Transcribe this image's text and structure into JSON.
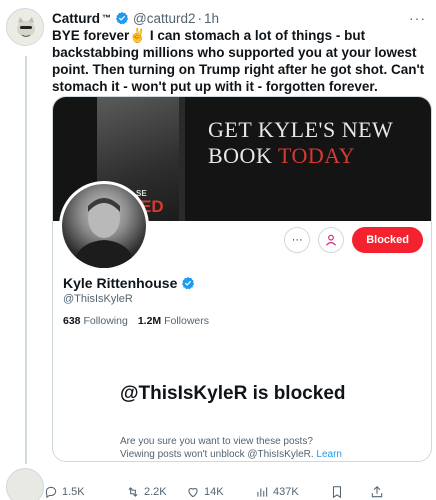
{
  "tweet": {
    "author_name": "Catturd",
    "author_tm": "™",
    "handle": "@catturd2",
    "separator": "·",
    "time": "1h",
    "more": "···",
    "text": "BYE forever✌️ I can stomach a lot of things - but backstabbing millions who supported you at your lowest point. Then turning on Trump right after he got shot. Can't stomach it - won't put up with it - forgotten forever."
  },
  "embed": {
    "banner": {
      "line1": "GET KYLE'S NEW",
      "line2_plain": "BOOK ",
      "line2_accent": "TODAY",
      "book_fragment_top": "SE",
      "book_fragment_bottom": "ED"
    },
    "profile": {
      "name": "Kyle Rittenhouse",
      "handle": "@ThisIsKyleR",
      "following_count": "638",
      "following_label": "Following",
      "followers_count": "1.2M",
      "followers_label": "Followers"
    },
    "actions": {
      "more": "···",
      "blocked_label": "Blocked"
    },
    "block_notice": {
      "title": "@ThisIsKyleR is blocked",
      "description": "Are you sure you want to view these posts? Viewing posts won't unblock @ThisIsKyleR.",
      "link": "Learn more"
    }
  },
  "action_bar": {
    "replies": "1.5K",
    "reposts": "2.2K",
    "likes": "14K",
    "views": "437K"
  },
  "colors": {
    "verified": "#1d9bf0",
    "blocked": "#f4212e",
    "link": "#1d9bf0",
    "banner_accent": "#d33a32"
  }
}
